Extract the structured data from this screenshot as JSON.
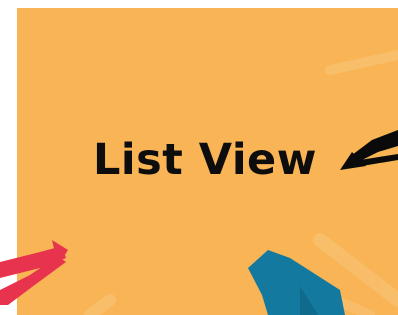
{
  "slide": {
    "title": "List View"
  },
  "colors": {
    "background": "#ffffff",
    "card": "#f8b455",
    "title": "#0d0d0d",
    "arrow_black": "#0a0a0a",
    "arrow_red": "#e8334f",
    "arrow_blue": "#13799f"
  },
  "icons": {
    "right_arrow": "black-arrow-icon",
    "left_arrow": "red-arrow-icon",
    "bottom_arrow": "blue-arrow-icon"
  }
}
